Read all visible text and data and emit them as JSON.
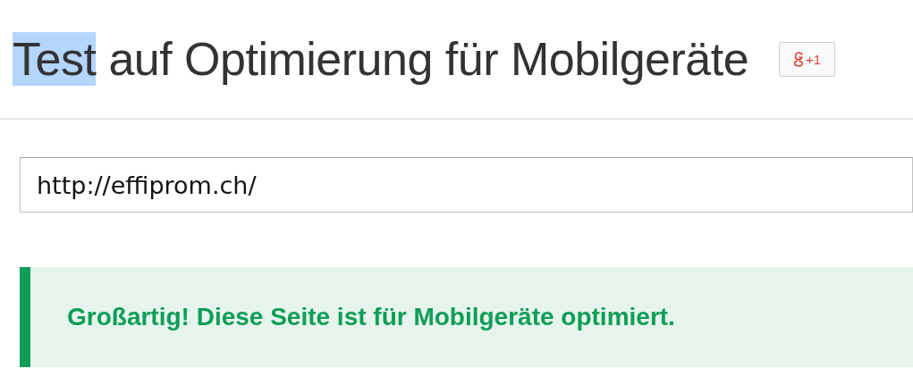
{
  "title": {
    "parts": [
      {
        "text": "Test",
        "selected": true
      },
      {
        "text": "auf Optimierung für Mobilgeräte",
        "selected": false
      }
    ]
  },
  "share_button": {
    "label": "+1"
  },
  "url_field": {
    "value": "http://effiprom.ch/"
  },
  "result": {
    "kind": "success",
    "message": "Großartig! Diese Seite ist für Mobilgeräte optimiert."
  }
}
